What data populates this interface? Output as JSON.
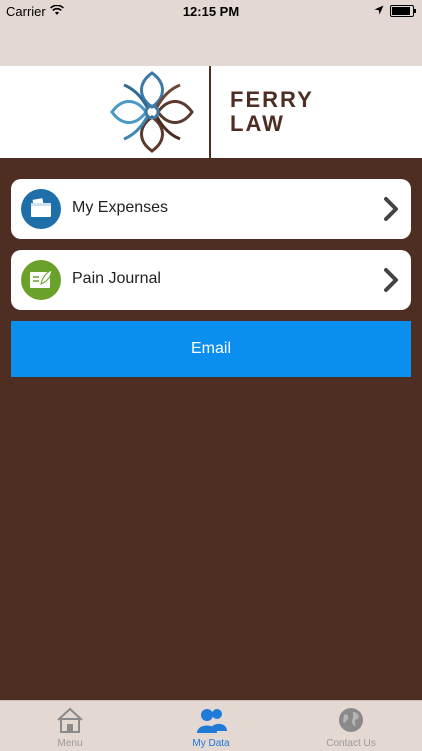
{
  "status_bar": {
    "carrier": "Carrier",
    "time": "12:15 PM"
  },
  "brand": {
    "line1": "FERRY",
    "line2": "LAW"
  },
  "menu_items": [
    {
      "label": "My Expenses",
      "icon": "wallet-icon",
      "icon_color": "#1d6ea9"
    },
    {
      "label": "Pain Journal",
      "icon": "journal-icon",
      "icon_color": "#6aa12a"
    }
  ],
  "email_button": {
    "label": "Email",
    "color": "#0b8fee"
  },
  "tabs": [
    {
      "label": "Menu",
      "icon": "home-icon",
      "active": false
    },
    {
      "label": "My Data",
      "icon": "users-icon",
      "active": true
    },
    {
      "label": "Contact Us",
      "icon": "globe-icon",
      "active": false
    }
  ],
  "colors": {
    "background": "#4e2e22",
    "header": "#ffffff",
    "active_tab": "#1f7ad8"
  }
}
